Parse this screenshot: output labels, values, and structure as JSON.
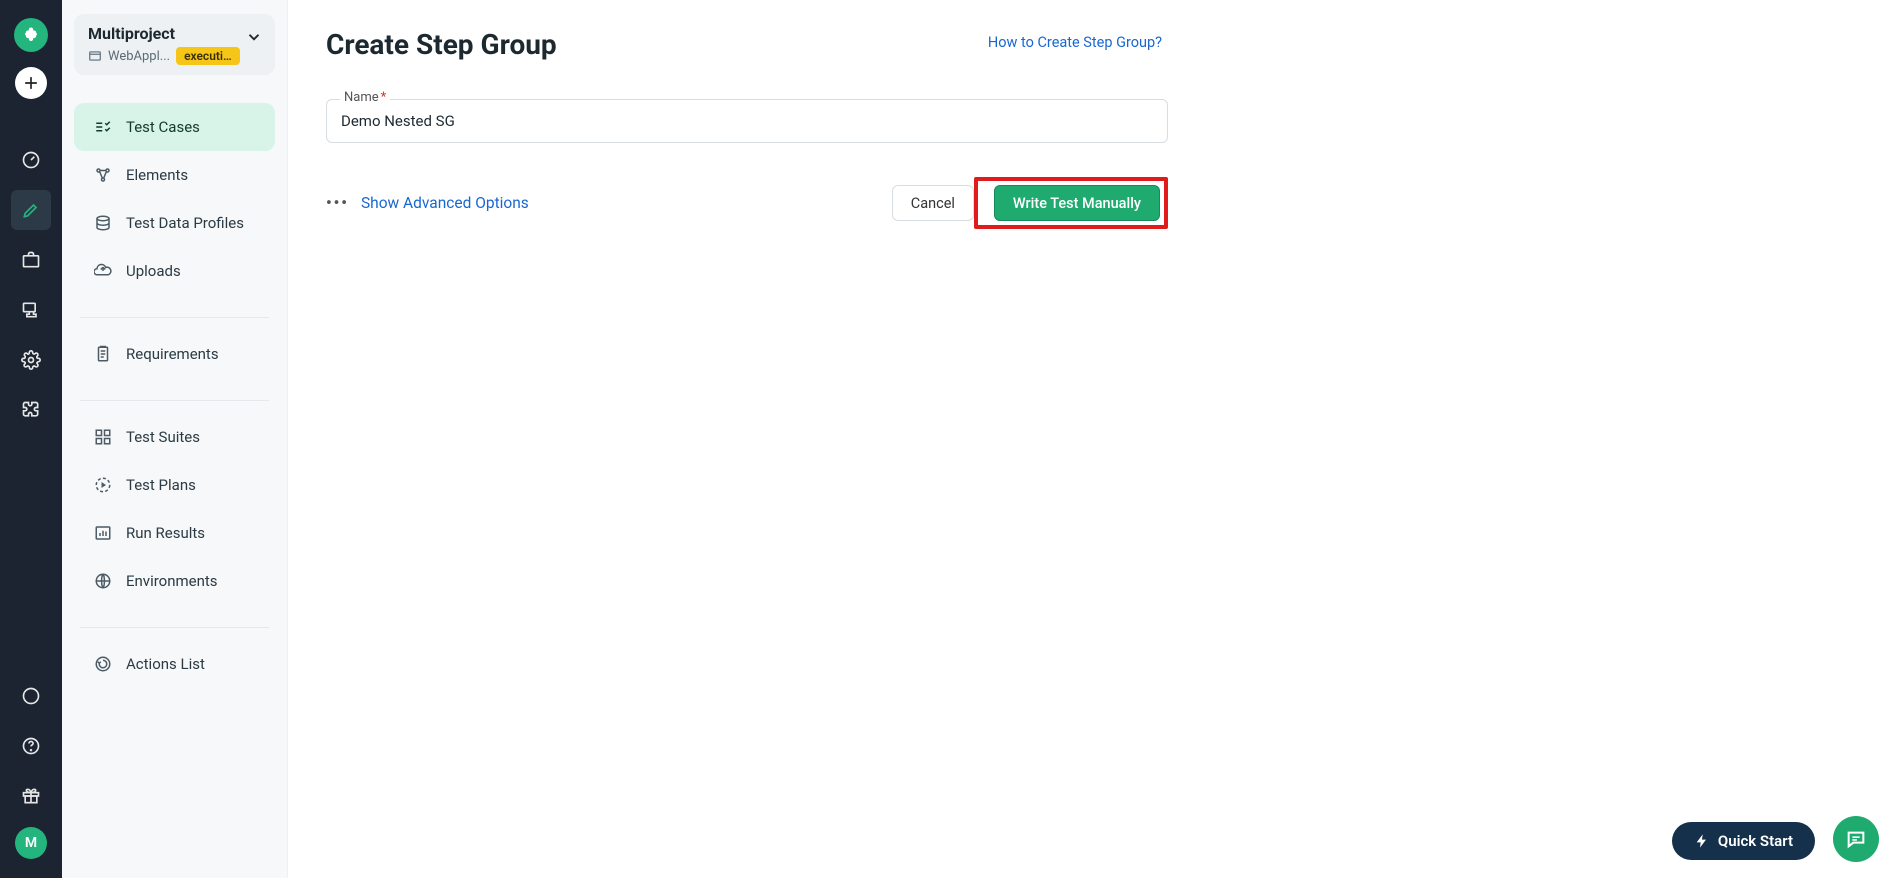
{
  "rail": {
    "avatar_letter": "M"
  },
  "project": {
    "title": "Multiproject",
    "sub": "WebAppl...",
    "badge": "executio..."
  },
  "sidebar": {
    "test_cases": "Test Cases",
    "elements": "Elements",
    "test_data": "Test Data Profiles",
    "uploads": "Uploads",
    "requirements": "Requirements",
    "test_suites": "Test Suites",
    "test_plans": "Test Plans",
    "run_results": "Run Results",
    "environments": "Environments",
    "actions_list": "Actions List"
  },
  "main": {
    "title": "Create Step Group",
    "help_link": "How to Create Step Group?",
    "field_label": "Name",
    "name_value": "Demo Nested SG",
    "adv_options": "Show Advanced Options",
    "cancel": "Cancel",
    "primary": "Write Test Manually"
  },
  "float": {
    "quick_start": "Quick Start"
  }
}
